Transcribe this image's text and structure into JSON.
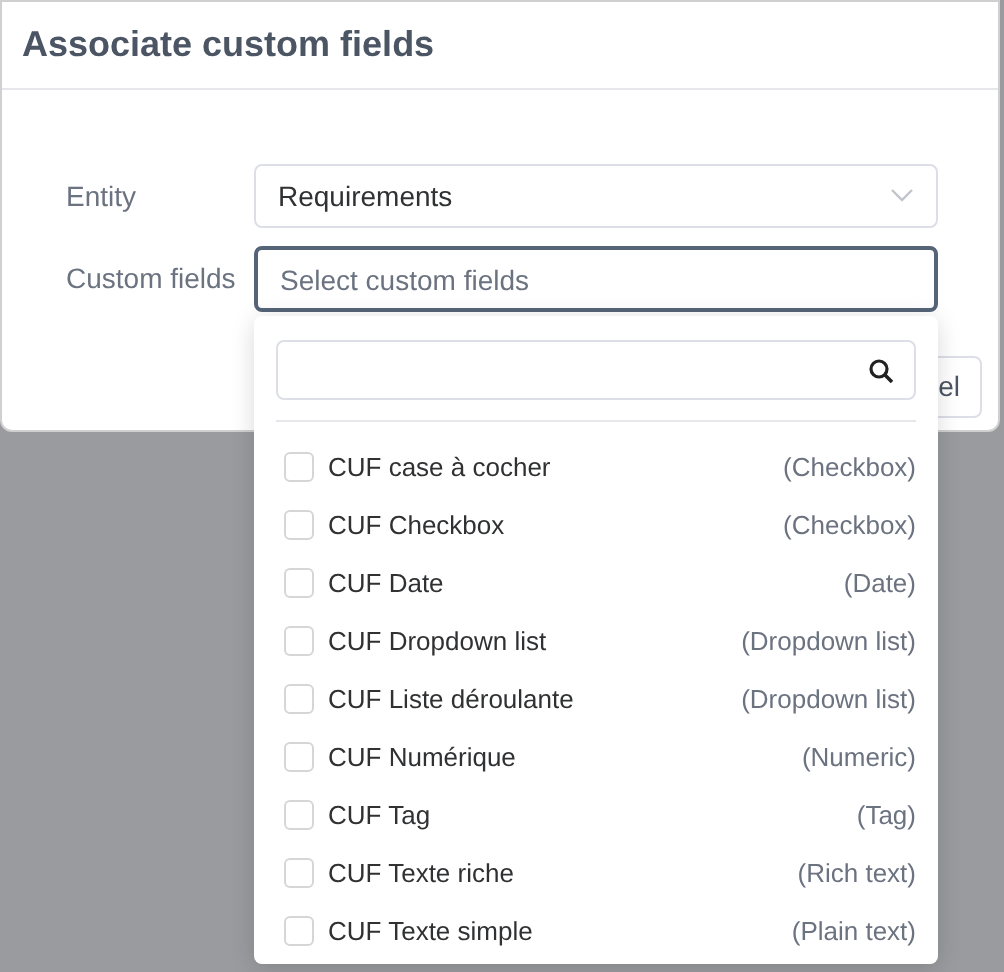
{
  "dialog": {
    "title": "Associate custom fields",
    "fields": [
      {
        "label": "Entity",
        "value": "Requirements"
      },
      {
        "label": "Custom fields",
        "placeholder": "Select custom fields",
        "focused": true
      }
    ],
    "buttons": [
      "el"
    ]
  },
  "dropdown": {
    "options": [
      {
        "name": "CUF case à cocher",
        "type": "(Checkbox)",
        "checked": false
      },
      {
        "name": "CUF Checkbox",
        "type": "(Checkbox)",
        "checked": false
      },
      {
        "name": "CUF Date",
        "type": "(Date)",
        "checked": false
      },
      {
        "name": "CUF Dropdown list",
        "type": "(Dropdown list)",
        "checked": false
      },
      {
        "name": "CUF Liste déroulante",
        "type": "(Dropdown list)",
        "checked": false
      },
      {
        "name": "CUF Numérique",
        "type": "(Numeric)",
        "checked": false
      },
      {
        "name": "CUF Tag",
        "type": "(Tag)",
        "checked": false
      },
      {
        "name": "CUF Texte riche",
        "type": "(Rich text)",
        "checked": false
      },
      {
        "name": "CUF Texte simple",
        "type": "(Plain text)",
        "checked": false
      }
    ]
  }
}
